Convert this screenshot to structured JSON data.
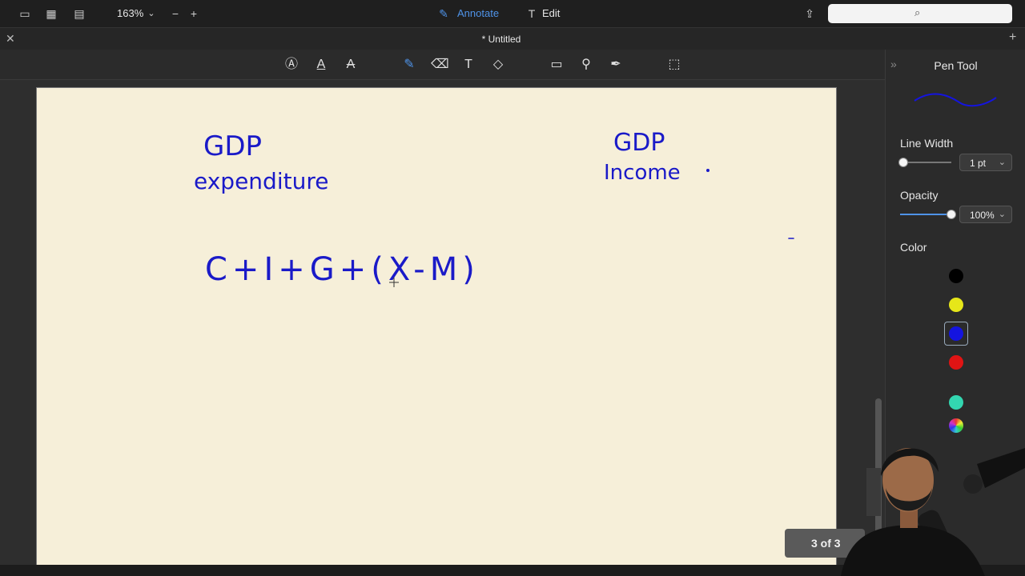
{
  "topbar": {
    "zoom_level": "163%",
    "annotate_label": "Annotate",
    "edit_label": "Edit",
    "annotate_color": "#4f93e8"
  },
  "titlebar": {
    "title": "* Untitled"
  },
  "panel": {
    "title": "Pen Tool",
    "line_width_label": "Line Width",
    "line_width_value": "1 pt",
    "opacity_label": "Opacity",
    "opacity_value": "100%",
    "opacity_level": 1.0,
    "color_label": "Color",
    "colors": [
      "#000000",
      "#e6e619",
      "#1414e0",
      "#e01414",
      "#33d6b0"
    ],
    "selected_color": "#1414e0"
  },
  "page_indicator": "3 of 3",
  "handwriting": {
    "left_title_line1": "GDP",
    "left_title_line2": "expenditure",
    "right_title_line1": "GDP",
    "right_title_line2": "Income",
    "formula": "C+I+G+(X-M)",
    "ink_color": "#1a1ac8"
  }
}
